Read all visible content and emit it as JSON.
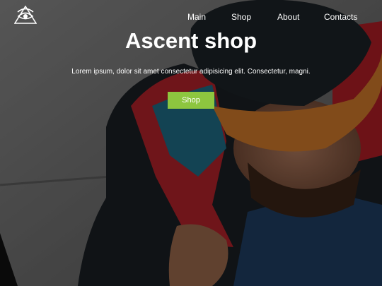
{
  "brand": {
    "logo_icon": "triangle-eye-logo-icon"
  },
  "nav": {
    "items": [
      {
        "label": "Main"
      },
      {
        "label": "Shop"
      },
      {
        "label": "About"
      },
      {
        "label": "Contacts"
      }
    ]
  },
  "hero": {
    "title": "Ascent shop",
    "subtitle": "Lorem ipsum, dolor sit amet consectetur adipisicing elit. Consectetur, magni.",
    "cta_label": "Shop"
  },
  "colors": {
    "accent": "#8dc63f",
    "text": "#ffffff",
    "overlay": "rgba(0,0,0,0.38)"
  }
}
